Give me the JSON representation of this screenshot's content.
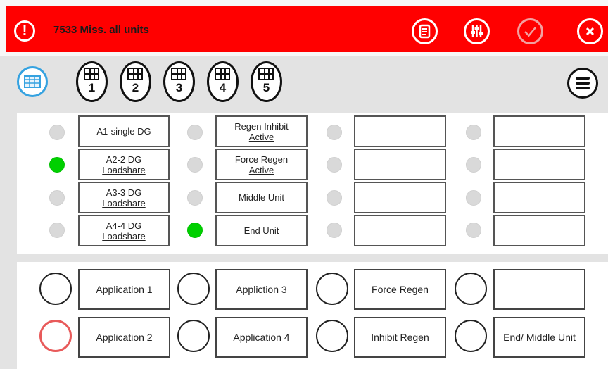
{
  "alarm": {
    "text": "7533 Miss. all units",
    "color": "#ff0000"
  },
  "header_buttons": [
    "document-icon",
    "sliders-icon",
    "check-icon",
    "close-icon"
  ],
  "toolbar": {
    "pages": [
      "1",
      "2",
      "3",
      "4",
      "5"
    ]
  },
  "indicators": {
    "col1": [
      {
        "label": "A1-single DG",
        "on": false
      },
      {
        "label1": "A2-2 DG",
        "label2": "Loadshare",
        "on": true
      },
      {
        "label1": "A3-3 DG",
        "label2": "Loadshare",
        "on": false
      },
      {
        "label1": "A4-4 DG",
        "label2": "Loadshare",
        "on": false
      }
    ],
    "col2": [
      {
        "label1": "Regen Inhibit",
        "label2": "Active",
        "on": false
      },
      {
        "label1": "Force Regen",
        "label2": "Active",
        "on": false
      },
      {
        "label": "Middle Unit",
        "on": false
      },
      {
        "label": "End Unit",
        "on": true
      }
    ]
  },
  "controls": {
    "row1": [
      "Application 1",
      "Appliction 3",
      "Force Regen",
      ""
    ],
    "row2": [
      "Application 2",
      "Application 4",
      "Inhibit Regen",
      "End/ Middle Unit"
    ]
  },
  "colors": {
    "led_on": "#00d000",
    "led_off": "#d9d9d9",
    "accent": "#35a2e0",
    "selected": "#e85a5a"
  }
}
